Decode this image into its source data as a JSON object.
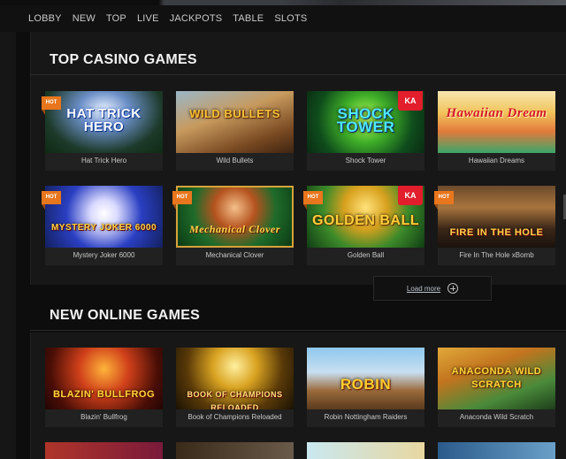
{
  "nav": [
    "LOBBY",
    "NEW",
    "TOP",
    "LIVE",
    "JACKPOTS",
    "TABLE",
    "SLOTS"
  ],
  "top_section": {
    "title": "TOP CASINO GAMES",
    "load_more": "Load more",
    "games": [
      {
        "name": "Hat Trick Hero",
        "logo": "HAT TRICK HERO",
        "hot": "HOT"
      },
      {
        "name": "Wild Bullets",
        "logo": "WILD BULLETS",
        "hot": ""
      },
      {
        "name": "Shock Tower",
        "logo": "SHOCK TOWER",
        "hot": "",
        "badge": "KA"
      },
      {
        "name": "Hawaiian Dreams",
        "logo": "Hawaiian Dream",
        "hot": ""
      },
      {
        "name": "Mystery Joker 6000",
        "logo": "MYSTERY JOKER 6000",
        "hot": "HOT"
      },
      {
        "name": "Mechanical Clover",
        "logo": "Mechanical Clover",
        "hot": "HOT"
      },
      {
        "name": "Golden Ball",
        "logo": "GOLDEN BALL",
        "hot": "HOT",
        "badge": "KA"
      },
      {
        "name": "Fire In The Hole xBomb",
        "logo": "FIRE IN THE HOLE",
        "hot": "HOT"
      }
    ]
  },
  "new_section": {
    "title": "NEW ONLINE GAMES",
    "games": [
      {
        "name": "Blazin' Bullfrog",
        "logo": "BLAZIN' BULLFROG"
      },
      {
        "name": "Book of Champions Reloaded",
        "logo": "BOOK OF CHAMPIONS RELOADED"
      },
      {
        "name": "Robin Nottingham Raiders",
        "logo": "ROBIN"
      },
      {
        "name": "Anaconda Wild Scratch",
        "logo": "ANACONDA WILD SCRATCH"
      }
    ]
  },
  "colors": {
    "hot_badge": "#e8761d",
    "kiya_badge": "#e21d2c",
    "panel": "#171717"
  }
}
